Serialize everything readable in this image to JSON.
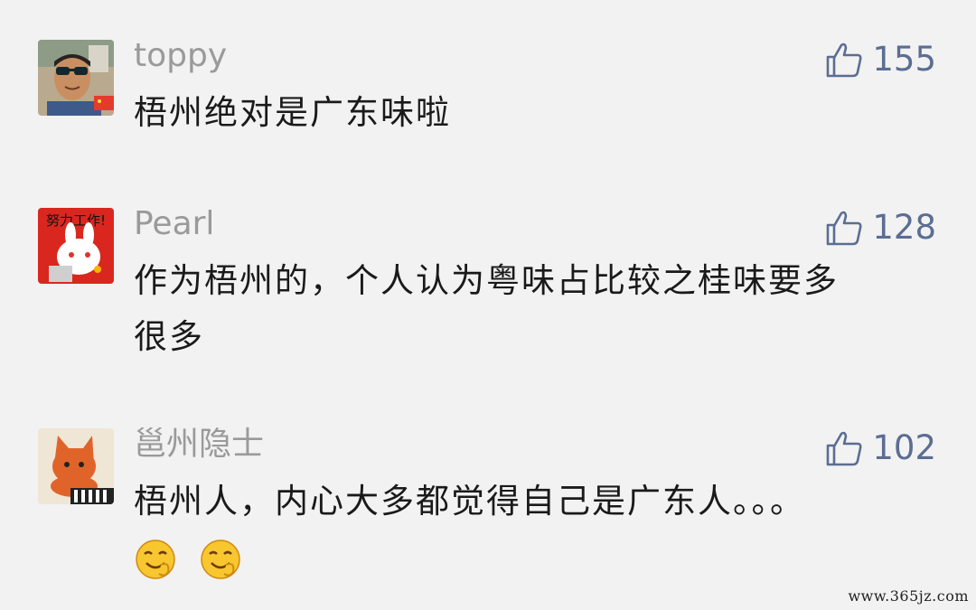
{
  "comments": [
    {
      "name": "toppy",
      "text": "梧州绝对是广东味啦",
      "likes": "155",
      "avatar": "avatar-sunglasses-man"
    },
    {
      "name": "Pearl",
      "text_line1": "作为梧州的，个人认为粤味占比较之桂味要多",
      "text_line2": "很多",
      "likes": "128",
      "avatar": "avatar-bunny-sticker",
      "avatar_caption": "努力工作!"
    },
    {
      "name": "邕州隐士",
      "text": "梧州人，内心大多都觉得自己是广东人。。。",
      "likes": "102",
      "avatar": "avatar-cat-piano"
    }
  ],
  "watermark": "www.365jz.com",
  "colors": {
    "like": "#5b6d92",
    "name": "#9a9a9a",
    "text": "#1a1a1a",
    "background": "#f2f2f2"
  }
}
